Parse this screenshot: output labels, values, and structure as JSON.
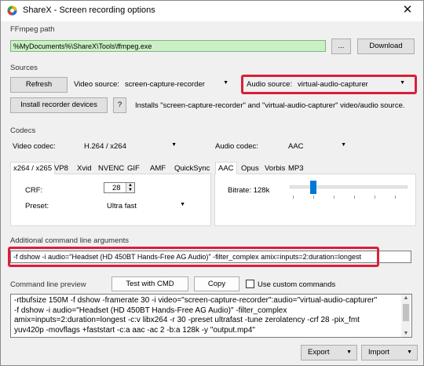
{
  "window": {
    "title": "ShareX - Screen recording options",
    "close_glyph": "✕"
  },
  "ffmpeg": {
    "group_label": "FFmpeg path",
    "path_value": "%MyDocuments%\\ShareX\\Tools\\ffmpeg.exe",
    "browse_label": "...",
    "download_label": "Download"
  },
  "sources": {
    "group_label": "Sources",
    "refresh_label": "Refresh",
    "video_source_label": "Video source:",
    "video_source_value": "screen-capture-recorder",
    "audio_source_label": "Audio source:",
    "audio_source_value": "virtual-audio-capturer",
    "install_label": "Install recorder devices",
    "help_label": "?",
    "install_note": "Installs \"screen-capture-recorder\" and \"virtual-audio-capturer\" video/audio source."
  },
  "codecs": {
    "group_label": "Codecs",
    "video_codec_label": "Video codec:",
    "video_codec_value": "H.264 / x264",
    "audio_codec_label": "Audio codec:",
    "audio_codec_value": "AAC",
    "video_tabs": [
      "x264 / x265",
      "VP8",
      "Xvid",
      "NVENC",
      "GIF",
      "AMF",
      "QuickSync"
    ],
    "crf_label": "CRF:",
    "crf_value": "28",
    "preset_label": "Preset:",
    "preset_value": "Ultra fast",
    "audio_tabs": [
      "AAC",
      "Opus",
      "Vorbis",
      "MP3"
    ],
    "bitrate_label": "Bitrate: 128k",
    "bitrate_slider_fraction": 0.18
  },
  "args": {
    "group_label": "Additional command line arguments",
    "value": "-f dshow -i audio=\"Headset (HD 450BT Hands-Free AG Audio)\" -filter_complex amix=inputs=2:duration=longest"
  },
  "preview": {
    "label": "Command line preview",
    "test_label": "Test with CMD",
    "copy_label": "Copy",
    "custom_label": "Use custom commands",
    "custom_checked": false,
    "lines": [
      "-rtbufsize 150M -f dshow -framerate 30 -i video=\"screen-capture-recorder\":audio=\"virtual-audio-capturer\"",
      "-f dshow -i audio=\"Headset (HD 450BT Hands-Free AG Audio)\" -filter_complex",
      "amix=inputs=2:duration=longest -c:v libx264 -r 30 -preset ultrafast -tune zerolatency -crf 28 -pix_fmt",
      "yuv420p -movflags +faststart -c:a aac -ac 2 -b:a 128k -y \"output.mp4\""
    ]
  },
  "footer": {
    "export_label": "Export",
    "import_label": "Import"
  },
  "colors": {
    "accent": "#0078d7",
    "highlight": "#d8203a",
    "path_bg": "#ccf0c6"
  }
}
